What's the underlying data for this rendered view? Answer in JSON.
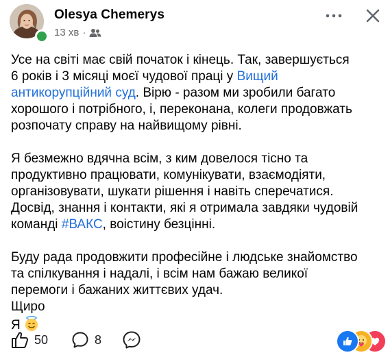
{
  "post": {
    "author": "Olesya Chemerys",
    "time": "13 хв",
    "separator": "·",
    "audience_icon": "friends-icon",
    "paragraphs": [
      {
        "lines": [
          [
            {
              "text": "Усе на світі має свій початок і кінець. Так, завершується"
            }
          ],
          [
            {
              "text": "6 років і 3 місяці моєї чудової праці у "
            },
            {
              "text": "Вищий",
              "link": true
            }
          ],
          [
            {
              "text": "антикорупційний суд",
              "link": true
            },
            {
              "text": ". Вірю - разом ми зробили багато"
            }
          ],
          [
            {
              "text": "хорошого і потрібного, і, переконана, колеги продовжать"
            }
          ],
          [
            {
              "text": "розпочату справу на найвищому рівні."
            }
          ]
        ]
      },
      {
        "lines": [
          [
            {
              "text": "Я безмежно вдячна всім, з ким довелося тісно та"
            }
          ],
          [
            {
              "text": "продуктивно працювати, комунікувати, взаємодіяти,"
            }
          ],
          [
            {
              "text": "організовувати, шукати рішення і навіть сперечатися."
            }
          ],
          [
            {
              "text": "Досвід, знання і контакти, які я отримала завдяки чудовій"
            }
          ],
          [
            {
              "text": "команді "
            },
            {
              "text": "#ВАКС",
              "link": true
            },
            {
              "text": ", воістину безцінні."
            }
          ]
        ]
      },
      {
        "lines": [
          [
            {
              "text": "Буду рада продовжити професійне і людське знайомство"
            }
          ],
          [
            {
              "text": "та спілкування і надалі, і всім нам бажаю великої"
            }
          ],
          [
            {
              "text": "перемоги і бажаних життєвих удач."
            }
          ],
          [
            {
              "text": "Щиро"
            }
          ],
          [
            {
              "text": "Я "
            },
            {
              "emoji": "smiling-face-with-halo"
            }
          ]
        ]
      }
    ]
  },
  "footer": {
    "like_count": "50",
    "comment_count": "8",
    "icons": {
      "like": "like-icon",
      "comment": "comment-icon",
      "share": "messenger-icon"
    },
    "reactions": [
      "like-reaction",
      "care-reaction",
      "love-reaction"
    ]
  },
  "colors": {
    "link": "#216fdb",
    "online": "#31a24c",
    "like_reaction": "#1877f2",
    "love_reaction": "#f33e58",
    "care_reaction": "#f7b125",
    "muted": "#65676b"
  }
}
